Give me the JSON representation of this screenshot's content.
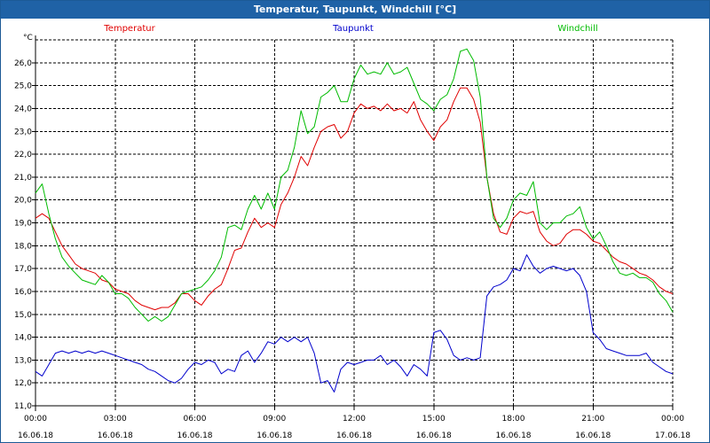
{
  "window": {
    "title": "Temperatur, Taupunkt, Windchill [°C]"
  },
  "chart_data": {
    "type": "line",
    "title": "Temperatur, Taupunkt, Windchill [°C]",
    "ylabel": "°C",
    "xlabel": "",
    "ylim": [
      11.0,
      27.0
    ],
    "yticks": [
      "11,0",
      "12,0",
      "13,0",
      "14,0",
      "15,0",
      "16,0",
      "17,0",
      "18,0",
      "19,0",
      "20,0",
      "21,0",
      "22,0",
      "23,0",
      "24,0",
      "25,0",
      "26,0"
    ],
    "x_time_labels": [
      "00:00",
      "03:00",
      "06:00",
      "09:00",
      "12:00",
      "15:00",
      "18:00",
      "21:00",
      "00:00"
    ],
    "x_date_labels": [
      "16.06.18",
      "16.06.18",
      "16.06.18",
      "16.06.18",
      "16.06.18",
      "16.06.18",
      "16.06.18",
      "16.06.18",
      "17.06.18"
    ],
    "xlim": [
      0,
      24
    ],
    "grid": true,
    "legend": "top",
    "series": [
      {
        "name": "Temperatur",
        "color": "#e00000",
        "points": [
          [
            0,
            19.2
          ],
          [
            0.25,
            19.4
          ],
          [
            0.5,
            19.2
          ],
          [
            0.75,
            18.6
          ],
          [
            1,
            18.0
          ],
          [
            1.25,
            17.6
          ],
          [
            1.5,
            17.2
          ],
          [
            1.75,
            17.0
          ],
          [
            2,
            16.9
          ],
          [
            2.25,
            16.8
          ],
          [
            2.5,
            16.5
          ],
          [
            2.75,
            16.4
          ],
          [
            3,
            16.1
          ],
          [
            3.25,
            16.0
          ],
          [
            3.5,
            15.9
          ],
          [
            3.75,
            15.6
          ],
          [
            4,
            15.4
          ],
          [
            4.25,
            15.3
          ],
          [
            4.5,
            15.2
          ],
          [
            4.75,
            15.3
          ],
          [
            5,
            15.3
          ],
          [
            5.25,
            15.5
          ],
          [
            5.5,
            15.9
          ],
          [
            5.75,
            15.9
          ],
          [
            6,
            15.6
          ],
          [
            6.25,
            15.4
          ],
          [
            6.5,
            15.8
          ],
          [
            6.75,
            16.1
          ],
          [
            7,
            16.3
          ],
          [
            7.25,
            17.0
          ],
          [
            7.5,
            17.8
          ],
          [
            7.75,
            17.9
          ],
          [
            8,
            18.6
          ],
          [
            8.25,
            19.2
          ],
          [
            8.5,
            18.8
          ],
          [
            8.75,
            19.0
          ],
          [
            9,
            18.8
          ],
          [
            9.25,
            19.8
          ],
          [
            9.5,
            20.3
          ],
          [
            9.75,
            21.0
          ],
          [
            10,
            21.9
          ],
          [
            10.25,
            21.5
          ],
          [
            10.5,
            22.3
          ],
          [
            10.75,
            23.0
          ],
          [
            11,
            23.2
          ],
          [
            11.25,
            23.3
          ],
          [
            11.5,
            22.7
          ],
          [
            11.75,
            23.0
          ],
          [
            12,
            23.8
          ],
          [
            12.25,
            24.2
          ],
          [
            12.5,
            24.0
          ],
          [
            12.75,
            24.1
          ],
          [
            13,
            23.9
          ],
          [
            13.25,
            24.2
          ],
          [
            13.5,
            23.9
          ],
          [
            13.75,
            24.0
          ],
          [
            14,
            23.8
          ],
          [
            14.25,
            24.3
          ],
          [
            14.5,
            23.5
          ],
          [
            14.75,
            23.0
          ],
          [
            15,
            22.6
          ],
          [
            15.25,
            23.2
          ],
          [
            15.5,
            23.5
          ],
          [
            15.75,
            24.3
          ],
          [
            16,
            24.9
          ],
          [
            16.25,
            24.9
          ],
          [
            16.5,
            24.4
          ],
          [
            16.75,
            23.4
          ],
          [
            17,
            21.0
          ],
          [
            17.25,
            19.4
          ],
          [
            17.5,
            18.6
          ],
          [
            17.75,
            18.5
          ],
          [
            18,
            19.2
          ],
          [
            18.25,
            19.5
          ],
          [
            18.5,
            19.4
          ],
          [
            18.75,
            19.5
          ],
          [
            19,
            18.6
          ],
          [
            19.25,
            18.2
          ],
          [
            19.5,
            18.0
          ],
          [
            19.75,
            18.1
          ],
          [
            20,
            18.5
          ],
          [
            20.25,
            18.7
          ],
          [
            20.5,
            18.7
          ],
          [
            20.75,
            18.5
          ],
          [
            21,
            18.2
          ],
          [
            21.25,
            18.1
          ],
          [
            21.5,
            17.8
          ],
          [
            21.75,
            17.5
          ],
          [
            22,
            17.3
          ],
          [
            22.25,
            17.2
          ],
          [
            22.5,
            17.0
          ],
          [
            22.75,
            16.8
          ],
          [
            23,
            16.7
          ],
          [
            23.25,
            16.5
          ],
          [
            23.5,
            16.2
          ],
          [
            23.75,
            16.0
          ],
          [
            24,
            15.9
          ]
        ]
      },
      {
        "name": "Taupunkt",
        "color": "#0000cc",
        "points": [
          [
            0,
            12.5
          ],
          [
            0.25,
            12.3
          ],
          [
            0.5,
            12.8
          ],
          [
            0.75,
            13.3
          ],
          [
            1,
            13.4
          ],
          [
            1.25,
            13.3
          ],
          [
            1.5,
            13.4
          ],
          [
            1.75,
            13.3
          ],
          [
            2,
            13.4
          ],
          [
            2.25,
            13.3
          ],
          [
            2.5,
            13.4
          ],
          [
            2.75,
            13.3
          ],
          [
            3,
            13.2
          ],
          [
            3.25,
            13.1
          ],
          [
            3.5,
            13.0
          ],
          [
            3.75,
            12.9
          ],
          [
            4,
            12.8
          ],
          [
            4.25,
            12.6
          ],
          [
            4.5,
            12.5
          ],
          [
            4.75,
            12.3
          ],
          [
            5,
            12.1
          ],
          [
            5.25,
            12.0
          ],
          [
            5.5,
            12.2
          ],
          [
            5.75,
            12.6
          ],
          [
            6,
            12.9
          ],
          [
            6.25,
            12.8
          ],
          [
            6.5,
            13.0
          ],
          [
            6.75,
            12.9
          ],
          [
            7,
            12.4
          ],
          [
            7.25,
            12.6
          ],
          [
            7.5,
            12.5
          ],
          [
            7.75,
            13.2
          ],
          [
            8,
            13.4
          ],
          [
            8.25,
            12.9
          ],
          [
            8.5,
            13.3
          ],
          [
            8.75,
            13.8
          ],
          [
            9,
            13.7
          ],
          [
            9.25,
            14.0
          ],
          [
            9.5,
            13.8
          ],
          [
            9.75,
            14.0
          ],
          [
            10,
            13.8
          ],
          [
            10.25,
            14.0
          ],
          [
            10.5,
            13.3
          ],
          [
            10.75,
            12.0
          ],
          [
            11,
            12.1
          ],
          [
            11.25,
            11.6
          ],
          [
            11.5,
            12.6
          ],
          [
            11.75,
            12.9
          ],
          [
            12,
            12.8
          ],
          [
            12.25,
            12.9
          ],
          [
            12.5,
            13.0
          ],
          [
            12.75,
            13.0
          ],
          [
            13,
            13.2
          ],
          [
            13.25,
            12.8
          ],
          [
            13.5,
            13.0
          ],
          [
            13.75,
            12.7
          ],
          [
            14,
            12.3
          ],
          [
            14.25,
            12.8
          ],
          [
            14.5,
            12.6
          ],
          [
            14.75,
            12.3
          ],
          [
            15,
            14.2
          ],
          [
            15.25,
            14.3
          ],
          [
            15.5,
            13.9
          ],
          [
            15.75,
            13.2
          ],
          [
            16,
            13.0
          ],
          [
            16.25,
            13.1
          ],
          [
            16.5,
            13.0
          ],
          [
            16.75,
            13.1
          ],
          [
            17,
            15.8
          ],
          [
            17.25,
            16.2
          ],
          [
            17.5,
            16.3
          ],
          [
            17.75,
            16.5
          ],
          [
            18,
            17.0
          ],
          [
            18.25,
            16.9
          ],
          [
            18.5,
            17.6
          ],
          [
            18.75,
            17.1
          ],
          [
            19,
            16.8
          ],
          [
            19.25,
            17.0
          ],
          [
            19.5,
            17.1
          ],
          [
            19.75,
            17.0
          ],
          [
            20,
            16.9
          ],
          [
            20.25,
            17.0
          ],
          [
            20.5,
            16.7
          ],
          [
            20.75,
            16.0
          ],
          [
            21,
            14.2
          ],
          [
            21.25,
            13.9
          ],
          [
            21.5,
            13.5
          ],
          [
            21.75,
            13.4
          ],
          [
            22,
            13.3
          ],
          [
            22.25,
            13.2
          ],
          [
            22.5,
            13.2
          ],
          [
            22.75,
            13.2
          ],
          [
            23,
            13.3
          ],
          [
            23.25,
            12.9
          ],
          [
            23.5,
            12.7
          ],
          [
            23.75,
            12.5
          ],
          [
            24,
            12.4
          ]
        ]
      },
      {
        "name": "Windchill",
        "color": "#00bb00",
        "points": [
          [
            0,
            20.3
          ],
          [
            0.25,
            20.7
          ],
          [
            0.5,
            19.4
          ],
          [
            0.75,
            18.3
          ],
          [
            1,
            17.5
          ],
          [
            1.25,
            17.1
          ],
          [
            1.5,
            16.8
          ],
          [
            1.75,
            16.5
          ],
          [
            2,
            16.4
          ],
          [
            2.25,
            16.3
          ],
          [
            2.5,
            16.7
          ],
          [
            2.75,
            16.4
          ],
          [
            3,
            15.9
          ],
          [
            3.25,
            15.9
          ],
          [
            3.5,
            15.7
          ],
          [
            3.75,
            15.3
          ],
          [
            4,
            15.0
          ],
          [
            4.25,
            14.7
          ],
          [
            4.5,
            14.9
          ],
          [
            4.75,
            14.7
          ],
          [
            5,
            14.9
          ],
          [
            5.25,
            15.4
          ],
          [
            5.5,
            15.9
          ],
          [
            5.75,
            16.0
          ],
          [
            6,
            16.1
          ],
          [
            6.25,
            16.2
          ],
          [
            6.5,
            16.5
          ],
          [
            6.75,
            16.9
          ],
          [
            7,
            17.5
          ],
          [
            7.25,
            18.8
          ],
          [
            7.5,
            18.9
          ],
          [
            7.75,
            18.7
          ],
          [
            8,
            19.6
          ],
          [
            8.25,
            20.2
          ],
          [
            8.5,
            19.6
          ],
          [
            8.75,
            20.3
          ],
          [
            9,
            19.6
          ],
          [
            9.25,
            21.0
          ],
          [
            9.5,
            21.3
          ],
          [
            9.75,
            22.3
          ],
          [
            10,
            23.9
          ],
          [
            10.25,
            22.9
          ],
          [
            10.5,
            23.2
          ],
          [
            10.75,
            24.5
          ],
          [
            11,
            24.7
          ],
          [
            11.25,
            25.0
          ],
          [
            11.5,
            24.3
          ],
          [
            11.75,
            24.3
          ],
          [
            12,
            25.3
          ],
          [
            12.25,
            25.9
          ],
          [
            12.5,
            25.5
          ],
          [
            12.75,
            25.6
          ],
          [
            13,
            25.5
          ],
          [
            13.25,
            26.0
          ],
          [
            13.5,
            25.5
          ],
          [
            13.75,
            25.6
          ],
          [
            14,
            25.8
          ],
          [
            14.25,
            25.1
          ],
          [
            14.5,
            24.4
          ],
          [
            14.75,
            24.2
          ],
          [
            15,
            23.9
          ],
          [
            15.25,
            24.4
          ],
          [
            15.5,
            24.6
          ],
          [
            15.75,
            25.3
          ],
          [
            16,
            26.5
          ],
          [
            16.25,
            26.6
          ],
          [
            16.5,
            26.1
          ],
          [
            16.75,
            24.5
          ],
          [
            17,
            21.0
          ],
          [
            17.25,
            19.2
          ],
          [
            17.5,
            18.8
          ],
          [
            17.75,
            19.2
          ],
          [
            18,
            20.0
          ],
          [
            18.25,
            20.3
          ],
          [
            18.5,
            20.2
          ],
          [
            18.75,
            20.8
          ],
          [
            19,
            19.0
          ],
          [
            19.25,
            18.7
          ],
          [
            19.5,
            19.0
          ],
          [
            19.75,
            19.0
          ],
          [
            20,
            19.3
          ],
          [
            20.25,
            19.4
          ],
          [
            20.5,
            19.7
          ],
          [
            20.75,
            18.8
          ],
          [
            21,
            18.3
          ],
          [
            21.25,
            18.6
          ],
          [
            21.5,
            18.0
          ],
          [
            21.75,
            17.3
          ],
          [
            22,
            16.8
          ],
          [
            22.25,
            16.7
          ],
          [
            22.5,
            16.8
          ],
          [
            22.75,
            16.6
          ],
          [
            23,
            16.6
          ],
          [
            23.25,
            16.4
          ],
          [
            23.5,
            15.9
          ],
          [
            23.75,
            15.6
          ],
          [
            24,
            15.1
          ]
        ]
      }
    ]
  }
}
